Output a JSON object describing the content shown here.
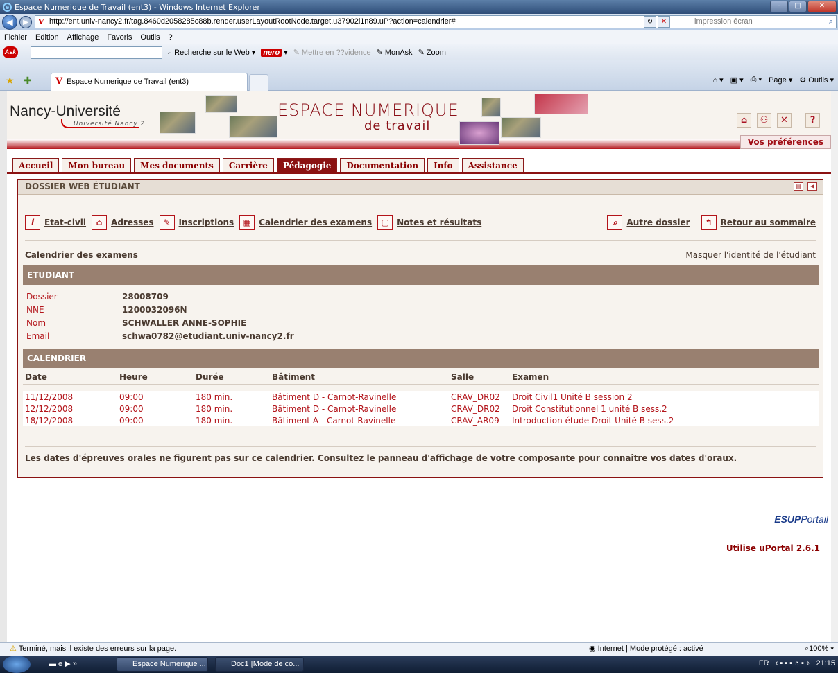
{
  "window": {
    "title": "Espace Numerique de Travail (ent3) - Windows Internet Explorer"
  },
  "address": {
    "url": "http://ent.univ-nancy2.fr/tag.8460d2058285c88b.render.userLayoutRootNode.target.u37902l1n89.uP?action=calendrier#",
    "search_placeholder": "impression écran"
  },
  "menu": [
    "Fichier",
    "Edition",
    "Affichage",
    "Favoris",
    "Outils",
    "?"
  ],
  "askbar": {
    "search_label": "Recherche sur le Web",
    "nero": "nero",
    "highlight": "Mettre en ??vidence",
    "monask": "MonAsk",
    "zoom": "Zoom"
  },
  "tab": {
    "title": "Espace Numerique de Travail (ent3)"
  },
  "commands": {
    "page": "Page",
    "tools": "Outils"
  },
  "header": {
    "logo": "Nancy-Université",
    "logo_sub": "Université Nancy 2",
    "title": "ESPACE NUMERIQUE",
    "subtitle": "de travail",
    "prefs": "Vos préférences"
  },
  "nav": [
    "Accueil",
    "Mon bureau",
    "Mes documents",
    "Carrière",
    "Pédagogie",
    "Documentation",
    "Info",
    "Assistance"
  ],
  "channel": {
    "title": "DOSSIER WEB ÉTUDIANT",
    "links": [
      {
        "icon": "i",
        "label": "Etat-civil"
      },
      {
        "icon": "⌂",
        "label": "Adresses"
      },
      {
        "icon": "✎",
        "label": "Inscriptions"
      },
      {
        "icon": "▦",
        "label": "Calendrier des examens"
      },
      {
        "icon": "▢",
        "label": "Notes et résultats"
      }
    ],
    "other_folder": "Autre dossier",
    "back": "Retour au sommaire",
    "section_title": "Calendrier des examens",
    "hide_identity": "Masquer l'identité de l'étudiant"
  },
  "student": {
    "heading": "ETUDIANT",
    "dossier_label": "Dossier",
    "dossier": "28008709",
    "nne_label": "NNE",
    "nne": "1200032096N",
    "nom_label": "Nom",
    "nom": "SCHWALLER ANNE-SOPHIE",
    "email_label": "Email",
    "email": "schwa0782@etudiant.univ-nancy2.fr"
  },
  "calendar": {
    "heading": "CALENDRIER",
    "columns": [
      "Date",
      "Heure",
      "Durée",
      "Bâtiment",
      "Salle",
      "Examen"
    ],
    "rows": [
      [
        "11/12/2008",
        "09:00",
        "180 min.",
        "Bâtiment D - Carnot-Ravinelle",
        "CRAV_DR02",
        "Droit Civil1 Unité B session 2"
      ],
      [
        "12/12/2008",
        "09:00",
        "180 min.",
        "Bâtiment D - Carnot-Ravinelle",
        "CRAV_DR02",
        "Droit Constitutionnel 1 unité B sess.2"
      ],
      [
        "18/12/2008",
        "09:00",
        "180 min.",
        "Bâtiment A - Carnot-Ravinelle",
        "CRAV_AR09",
        "Introduction étude Droit Unité B sess.2"
      ]
    ],
    "note": "Les dates d'épreuves orales ne figurent pas sur ce calendrier. Consultez le panneau d'affichage de votre composante pour connaître vos dates d'oraux."
  },
  "footer": {
    "esup1": "ESUP",
    "esup2": "Portail",
    "uportal": "Utilise uPortal 2.6.1"
  },
  "status": {
    "message": "Terminé, mais il existe des erreurs sur la page.",
    "zone": "Internet | Mode protégé : activé",
    "zoom": "100%"
  },
  "taskbar": {
    "item1": "Espace Numerique ...",
    "item2": "Doc1 [Mode de co...",
    "lang": "FR",
    "clock": "21:15"
  }
}
